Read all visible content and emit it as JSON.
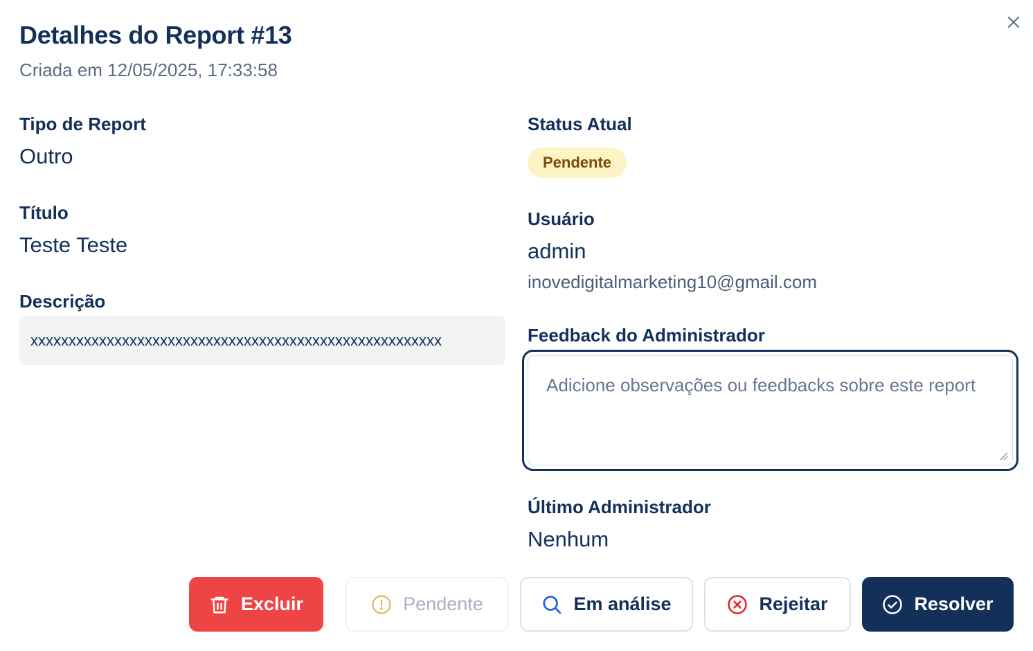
{
  "header": {
    "title": "Detalhes do Report #13",
    "subtitle": "Criada em 12/05/2025, 17:33:58"
  },
  "left": {
    "type_label": "Tipo de Report",
    "type_value": "Outro",
    "title_label": "Título",
    "title_value": "Teste Teste",
    "description_label": "Descrição",
    "description_value": "xxxxxxxxxxxxxxxxxxxxxxxxxxxxxxxxxxxxxxxxxxxxxxxxxxxxxx"
  },
  "right": {
    "status_label": "Status Atual",
    "status_value": "Pendente",
    "user_label": "Usuário",
    "user_name": "admin",
    "user_email": "inovedigitalmarketing10@gmail.com",
    "feedback_label": "Feedback do Administrador",
    "feedback_placeholder": "Adicione observações ou feedbacks sobre este report",
    "feedback_value": "",
    "last_admin_label": "Último Administrador",
    "last_admin_value": "Nenhum"
  },
  "actions": {
    "delete": "Excluir",
    "pending": "Pendente",
    "in_review": "Em análise",
    "reject": "Rejeitar",
    "resolve": "Resolver"
  },
  "colors": {
    "primary": "#12305a",
    "danger": "#ef4444",
    "badge_bg": "#fdf3c4",
    "badge_text": "#7a4a0c",
    "pending_icon": "#e0b860",
    "review_icon": "#2563eb",
    "reject_icon": "#dc2626"
  },
  "icons": {
    "close": "close-icon",
    "delete": "trash-icon",
    "pending": "alert-circle-icon",
    "in_review": "search-icon",
    "reject": "x-circle-icon",
    "resolve": "check-circle-icon"
  }
}
